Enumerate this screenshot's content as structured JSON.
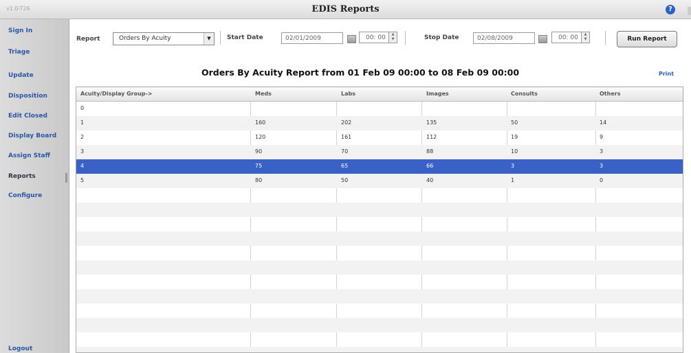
{
  "app": {
    "version": "v1.0-T26",
    "title": "EDIS Reports",
    "help_icon": "help-icon"
  },
  "sidebar": {
    "items": [
      {
        "label": "Sign In"
      },
      {
        "label": "Triage"
      },
      {
        "label": "Update"
      },
      {
        "label": "Disposition"
      },
      {
        "label": "Edit Closed"
      },
      {
        "label": "Display Board"
      },
      {
        "label": "Assign Staff"
      },
      {
        "label": "Reports"
      },
      {
        "label": "Configure"
      }
    ],
    "logout": "Logout"
  },
  "toolbar": {
    "report_label": "Report",
    "report_value": "Orders By Acuity",
    "start_label": "Start Date",
    "start_date": "02/01/2009",
    "start_time": "00: 00",
    "stop_label": "Stop Date",
    "stop_date": "02/08/2009",
    "stop_time": "00: 00",
    "run_label": "Run Report"
  },
  "report": {
    "title": "Orders By Acuity Report from 01 Feb 09 00:00 to 08 Feb 09 00:00",
    "print_label": "Print",
    "columns": [
      "Acuity/Display Group->",
      "Meds",
      "Labs",
      "Images",
      "Consults",
      "Others"
    ],
    "rows": [
      [
        "0",
        "",
        "",
        "",
        "",
        ""
      ],
      [
        "1",
        "160",
        "202",
        "135",
        "50",
        "14"
      ],
      [
        "2",
        "120",
        "161",
        "112",
        "19",
        "9"
      ],
      [
        "3",
        "90",
        "70",
        "88",
        "10",
        "3"
      ],
      [
        "4",
        "75",
        "65",
        "66",
        "3",
        "3"
      ],
      [
        "5",
        "80",
        "50",
        "40",
        "1",
        "0"
      ]
    ],
    "selected_row": 4
  },
  "colors": {
    "accent": "#2857a8",
    "selection": "#3a62c6",
    "help": "#2b62c8"
  }
}
